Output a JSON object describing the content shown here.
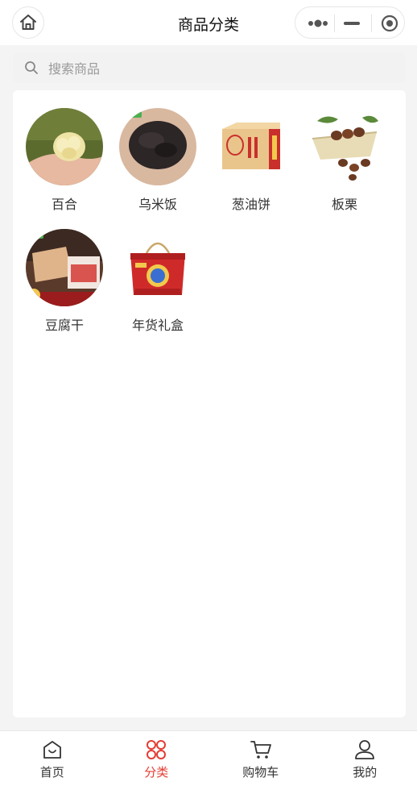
{
  "nav": {
    "title": "商品分类",
    "home_icon": "home-icon",
    "more_icon": "more-dots-icon",
    "minimize_icon": "minimize-icon",
    "close_icon": "target-close-icon"
  },
  "search": {
    "placeholder": "搜索商品",
    "icon": "search-icon"
  },
  "categories": [
    {
      "label": "百合"
    },
    {
      "label": "乌米饭"
    },
    {
      "label": "葱油饼"
    },
    {
      "label": "板栗"
    },
    {
      "label": "豆腐干"
    },
    {
      "label": "年货礼盒"
    }
  ],
  "tabbar": {
    "items": [
      {
        "label": "首页",
        "icon": "home-bag-icon",
        "active": false
      },
      {
        "label": "分类",
        "icon": "category-grid-icon",
        "active": true
      },
      {
        "label": "购物车",
        "icon": "cart-icon",
        "active": false
      },
      {
        "label": "我的",
        "icon": "user-icon",
        "active": false
      }
    ]
  },
  "colors": {
    "accent": "#e53c33",
    "background": "#f4f4f4",
    "panel": "#ffffff"
  }
}
